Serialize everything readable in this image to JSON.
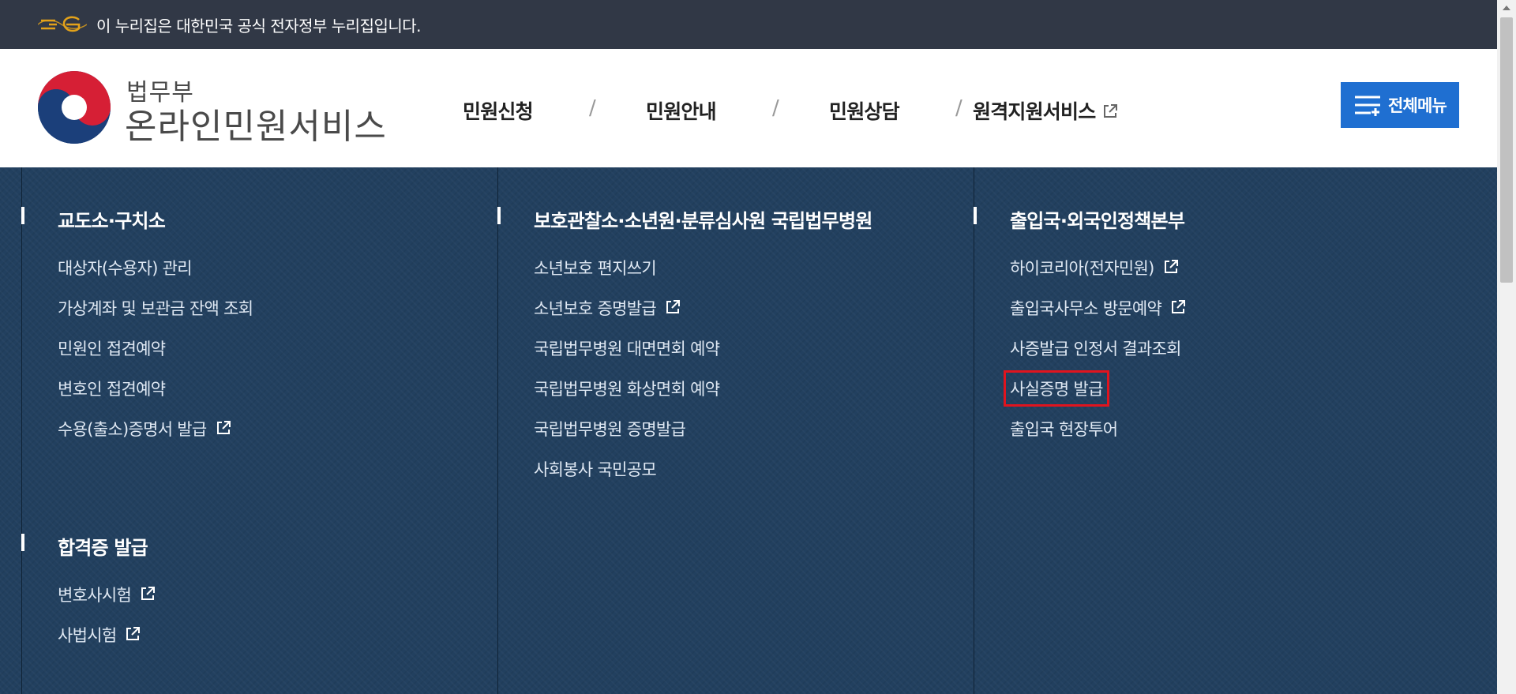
{
  "gov_banner": {
    "text": "이 누리집은 대한민국 공식 전자정부 누리집입니다."
  },
  "logo": {
    "small_text": "법무부",
    "big_text": "온라인민원서비스"
  },
  "gnb": {
    "items": [
      {
        "label": "민원신청"
      },
      {
        "label": "민원안내"
      },
      {
        "label": "민원상담"
      },
      {
        "label": "원격지원서비스",
        "external": true
      }
    ],
    "separator": "/"
  },
  "all_menu": {
    "label": "전체메뉴"
  },
  "mega_menu": {
    "sections": [
      {
        "title": "교도소·구치소",
        "links": [
          {
            "label": "대상자(수용자) 관리"
          },
          {
            "label": "가상계좌 및 보관금 잔액 조회"
          },
          {
            "label": "민원인 접견예약"
          },
          {
            "label": "변호인 접견예약"
          },
          {
            "label": "수용(출소)증명서 발급",
            "external": true
          }
        ]
      },
      {
        "title": "합격증 발급",
        "links": [
          {
            "label": "변호사시험",
            "external": true
          },
          {
            "label": "사법시험",
            "external": true
          }
        ]
      },
      {
        "title": "보호관찰소·소년원·분류심사원 국립법무병원",
        "links": [
          {
            "label": "소년보호 편지쓰기"
          },
          {
            "label": "소년보호 증명발급",
            "external": true
          },
          {
            "label": "국립법무병원 대면면회 예약"
          },
          {
            "label": "국립법무병원 화상면회 예약"
          },
          {
            "label": "국립법무병원 증명발급"
          },
          {
            "label": "사회봉사 국민공모"
          }
        ]
      },
      {
        "title": "출입국·외국인정책본부",
        "links": [
          {
            "label": "하이코리아(전자민원)",
            "external": true
          },
          {
            "label": "출입국사무소 방문예약",
            "external": true
          },
          {
            "label": "사증발급 인정서 결과조회"
          },
          {
            "label": "사실증명 발급",
            "highlighted": true
          },
          {
            "label": "출입국 현장투어"
          }
        ]
      }
    ]
  },
  "colors": {
    "gov_bar": "#313846",
    "panel": "#22405f",
    "accent_blue": "#1f6fd1",
    "highlight": "#e0141e"
  }
}
